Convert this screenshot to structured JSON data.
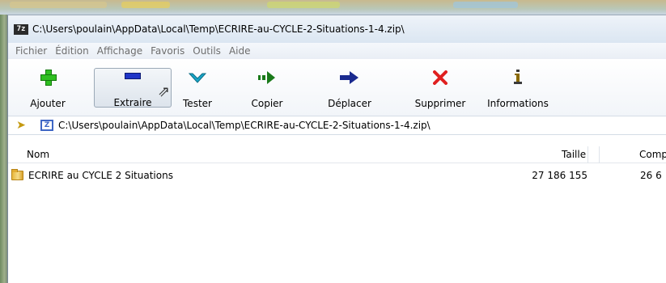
{
  "window": {
    "title": "C:\\Users\\poulain\\AppData\\Local\\Temp\\ECRIRE-au-CYCLE-2-Situations-1-4.zip\\",
    "app_icon_text": "7z"
  },
  "menu": [
    "Fichier",
    "Édition",
    "Affichage",
    "Favoris",
    "Outils",
    "Aide"
  ],
  "toolbar": {
    "add": "Ajouter",
    "extract": "Extraire",
    "test": "Tester",
    "copy": "Copier",
    "move": "Déplacer",
    "delete": "Supprimer",
    "info": "Informations"
  },
  "address": {
    "path": "C:\\Users\\poulain\\AppData\\Local\\Temp\\ECRIRE-au-CYCLE-2-Situations-1-4.zip\\"
  },
  "columns": {
    "name": "Nom",
    "size": "Taille",
    "compressed": "Comp"
  },
  "rows": [
    {
      "name": "ECRIRE au CYCLE 2 Situations",
      "size": "27 186 155",
      "compressed": "26 6"
    }
  ],
  "icons": {
    "add": "plus-icon",
    "extract": "minus-icon",
    "test": "check-icon",
    "copy": "copy-arrow-icon",
    "move": "move-arrow-icon",
    "delete": "delete-x-icon",
    "info": "info-icon"
  },
  "colors": {
    "add": "#2fbf21",
    "extract": "#1f35c7",
    "test": "#18a6c9",
    "copy": "#1a7a1a",
    "move": "#1a2a8f",
    "delete": "#e02020",
    "info": "#8a6a00"
  }
}
